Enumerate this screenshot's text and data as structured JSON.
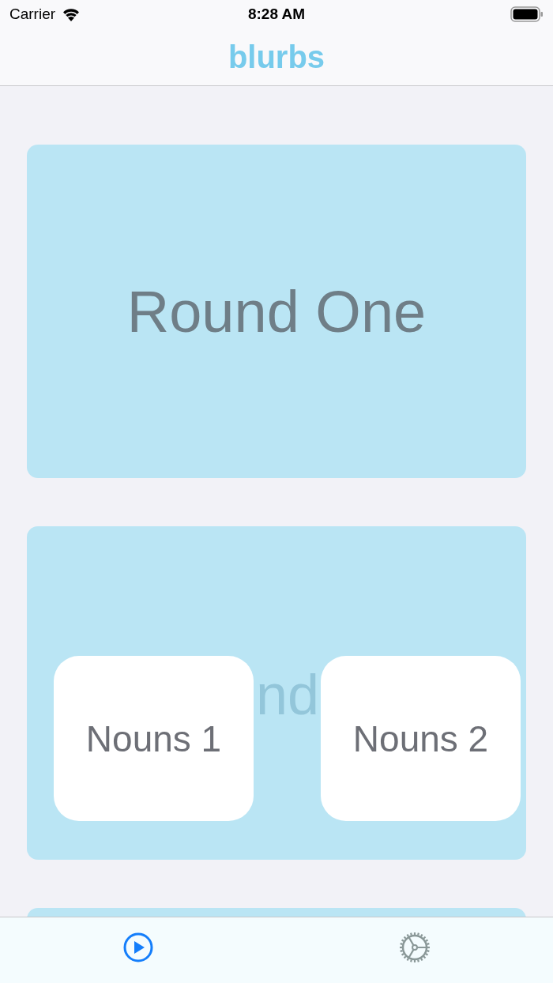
{
  "status_bar": {
    "carrier": "Carrier",
    "time": "8:28 AM"
  },
  "nav": {
    "title": "blurbs"
  },
  "cards": [
    {
      "kind": "title",
      "title": "Round One"
    },
    {
      "kind": "decks",
      "title": "nd",
      "decks": [
        "Nouns 1",
        "Nouns 2"
      ]
    },
    {
      "kind": "blank"
    }
  ],
  "tabs": [
    {
      "kind": "play",
      "selected": true
    },
    {
      "kind": "gear",
      "selected": false
    }
  ]
}
